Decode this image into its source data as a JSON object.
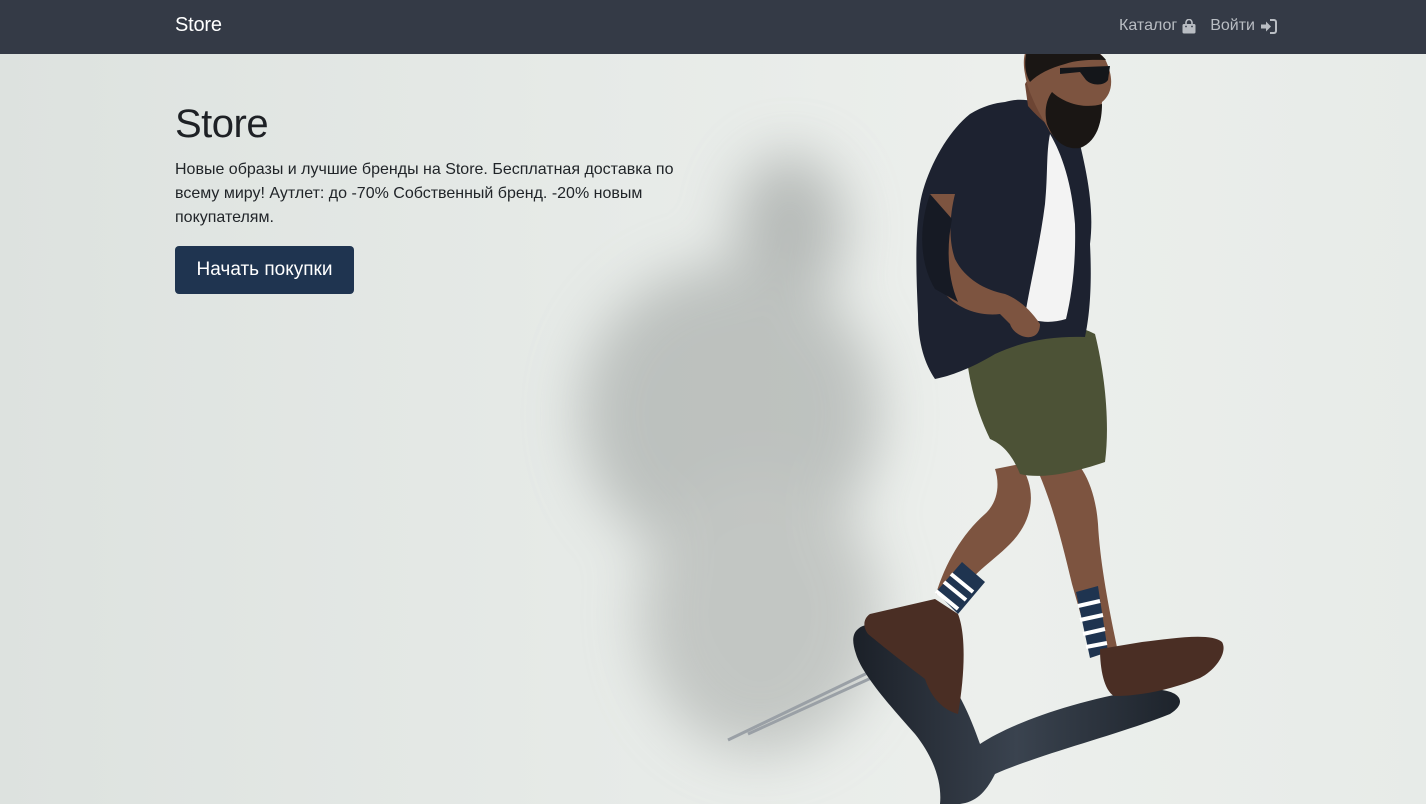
{
  "navbar": {
    "brand": "Store",
    "links": [
      {
        "label": "Каталог",
        "icon": "shopping-bag-icon"
      },
      {
        "label": "Войти",
        "icon": "sign-in-icon"
      }
    ]
  },
  "hero": {
    "title": "Store",
    "description": "Новые образы и лучшие бренды на Store. Бесплатная доставка по всему миру! Аутлет: до -70% Собственный бренд. -20% новым покупателям.",
    "cta_label": "Начать покупки"
  },
  "colors": {
    "navbar_bg": "#343a46",
    "cta_bg": "#1f3450",
    "hero_bg": "#e7ebe8"
  }
}
